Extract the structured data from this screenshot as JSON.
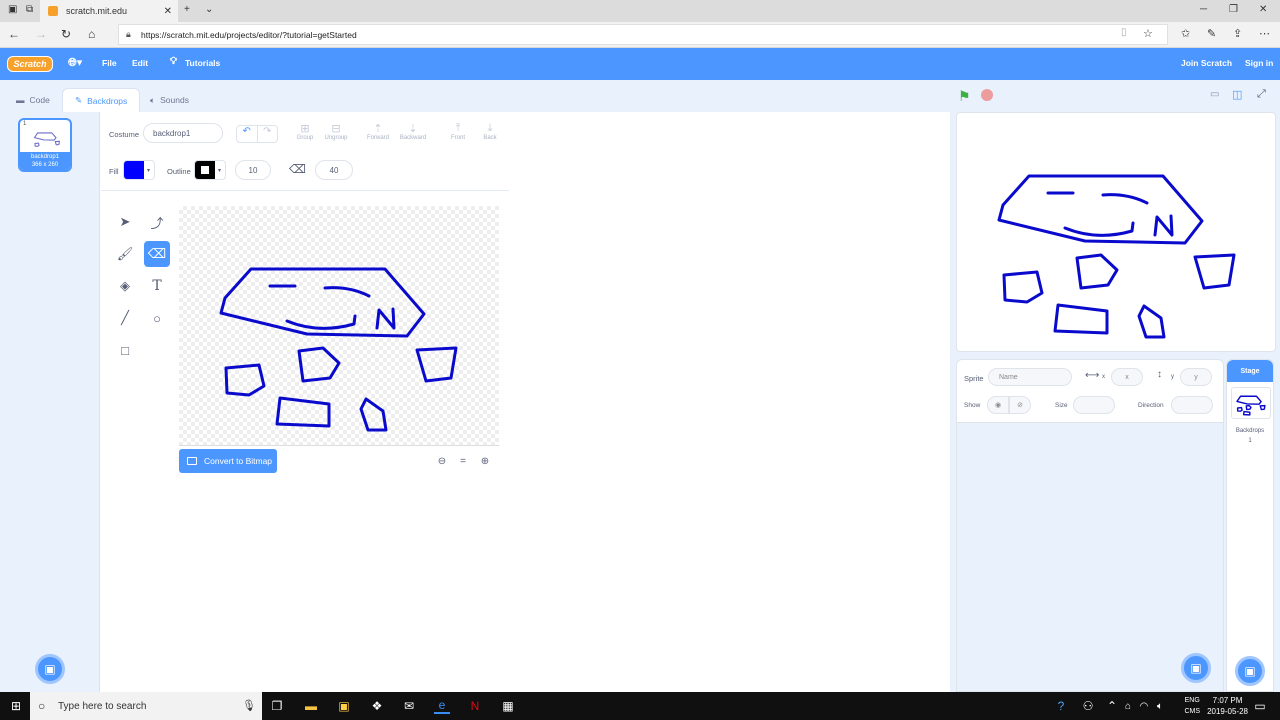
{
  "browser": {
    "tab_title": "scratch.mit.edu",
    "url": "https://scratch.mit.edu/projects/editor/?tutorial=getStarted"
  },
  "menubar": {
    "logo": "Scratch",
    "file": "File",
    "edit": "Edit",
    "tutorials": "Tutorials",
    "join": "Join Scratch",
    "signin": "Sign in"
  },
  "tabs": {
    "code": "Code",
    "backdrops": "Backdrops",
    "sounds": "Sounds"
  },
  "backdrop_list": {
    "items": [
      {
        "number": "1",
        "name": "backdrop1",
        "size": "366 x 260"
      }
    ]
  },
  "paint": {
    "costume_label": "Costume",
    "costume_name": "backdrop1",
    "group": "Group",
    "ungroup": "Ungroup",
    "forward": "Forward",
    "backward": "Backward",
    "front": "Front",
    "back": "Back",
    "fill_label": "Fill",
    "fill_color": "#0000ff",
    "outline_label": "Outline",
    "outline_color": "#000000",
    "outline_width": "10",
    "eraser_size": "40",
    "convert_button": "Convert to Bitmap",
    "drawing_color": "#0a0acc"
  },
  "sprite_info": {
    "sprite_label": "Sprite",
    "name_placeholder": "Name",
    "x_label": "x",
    "x_placeholder": "x",
    "y_label": "y",
    "y_placeholder": "y",
    "show_label": "Show",
    "size_label": "Size",
    "direction_label": "Direction"
  },
  "stage_pane": {
    "header": "Stage",
    "backdrops_label": "Backdrops",
    "backdrops_count": "1"
  },
  "taskbar": {
    "search_placeholder": "Type here to search",
    "lang_1": "ENG",
    "lang_2": "CMS",
    "time": "7:07 PM",
    "date": "2019-05-28"
  }
}
